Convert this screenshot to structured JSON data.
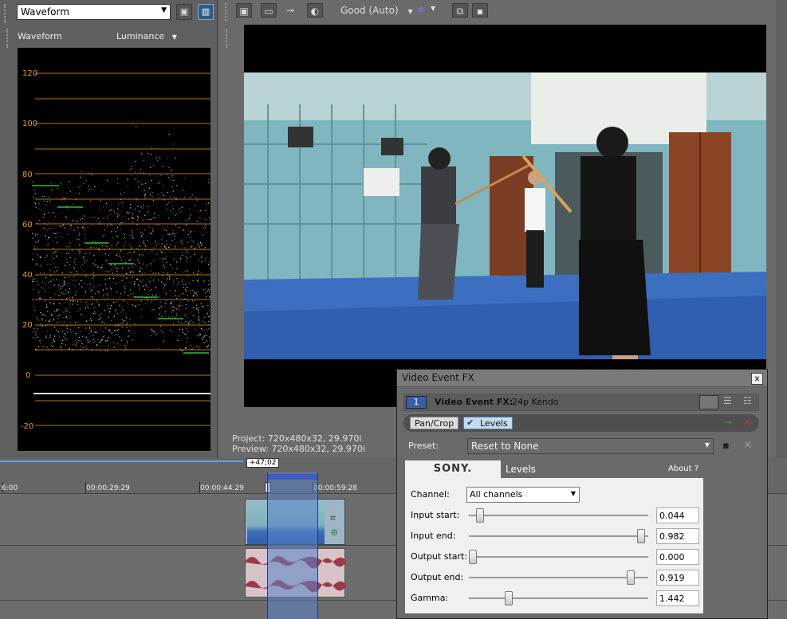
{
  "scopes": {
    "selector_value": "Waveform",
    "header_label": "Waveform",
    "mode": "Luminance",
    "scale_labels": [
      "120",
      "100",
      "80",
      "60",
      "40",
      "20",
      "0",
      "-20"
    ]
  },
  "preview": {
    "quality": "Good (Auto)",
    "project_info": "Project:   720x480x32, 29.970i",
    "preview_info": "Preview:  720x480x32, 29.970i"
  },
  "timeline": {
    "timecodes": [
      "6:00",
      "00:00:29:29",
      "00:00:44:29",
      "00:00:59:28"
    ],
    "region_length": "+47;02"
  },
  "fx_dialog": {
    "title": "Video Event FX",
    "close_label": "x",
    "chain_number": "1",
    "header_label": "Video Event FX:",
    "header_value": "24p Kendo",
    "chain": [
      {
        "label": "Pan/Crop"
      },
      {
        "label": "Levels"
      }
    ],
    "preset_label": "Preset:",
    "preset_value": "Reset to None",
    "plugin": {
      "brand": "SONY.",
      "name": "Levels",
      "about": "About  ?",
      "channel_label": "Channel:",
      "channel_value": "All channels",
      "params": [
        {
          "label": "Input start:",
          "value": "0.044",
          "level": 0.044
        },
        {
          "label": "Input end:",
          "value": "0.982",
          "level": 0.982
        },
        {
          "label": "Output start:",
          "value": "0.000",
          "level": 0.0
        },
        {
          "label": "Output end:",
          "value": "0.919",
          "level": 0.919
        },
        {
          "label": "Gamma:",
          "value": "1.442",
          "level": 0.21
        }
      ]
    }
  },
  "colors": {
    "accent": "#2c5d8a",
    "scope_grid": "#d98a1a",
    "scope_trace": "#e6e6e6",
    "waveform_marker": "#2fbf2f"
  }
}
